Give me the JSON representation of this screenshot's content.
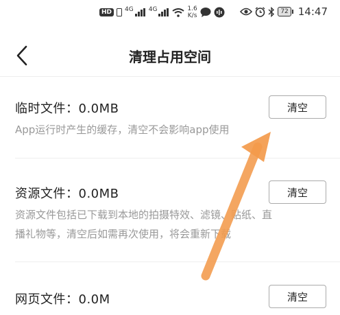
{
  "status_bar": {
    "hd_badge": "HD",
    "sim1_label": "4G",
    "sim2_label": "4G",
    "net_speed_value": "1.6",
    "net_speed_unit": "K/s",
    "battery": "72",
    "time": "14:47",
    "icons": [
      "sim-card-icon",
      "signal-icon",
      "wifi-icon",
      "chat-bubble-icon",
      "sound-wave-icon",
      "eye-icon",
      "alarm-icon",
      "bluetooth-icon",
      "battery-icon"
    ]
  },
  "header": {
    "title": "清理占用空间",
    "back_icon": "chevron-left-icon"
  },
  "sections": [
    {
      "title": "临时文件：0.0MB",
      "description_lines": [
        "App运行时产生的缓存，清空不会影响app使用"
      ],
      "button_label": "清空"
    },
    {
      "title": "资源文件：0.0MB",
      "description_lines": [
        "资源文件包括已下载到本地的拍摄特效、滤镜、贴纸、直",
        "播礼物等，清空后如需再次使用，将会重新下载"
      ],
      "button_label": "清空"
    },
    {
      "title": "网页文件：0.0M",
      "description_lines": [],
      "button_label": "清空"
    }
  ],
  "annotation": {
    "arrow_color": "#f39a4b"
  },
  "colors": {
    "title_text": "#222222",
    "description_text": "#999999",
    "button_border": "#aaaaaa",
    "divider": "#eeeeee"
  }
}
